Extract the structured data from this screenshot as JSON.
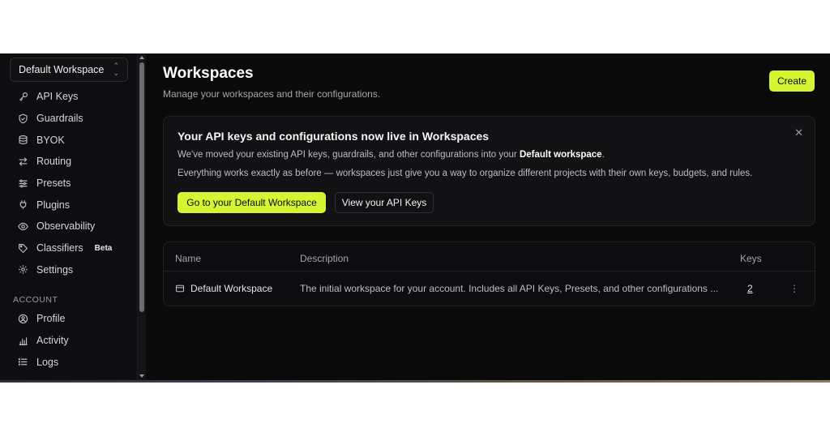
{
  "workspace_selector": {
    "label": "Default Workspace"
  },
  "sidebar": {
    "items": [
      {
        "label": "API Keys",
        "icon": "key-icon"
      },
      {
        "label": "Guardrails",
        "icon": "shield-icon"
      },
      {
        "label": "BYOK",
        "icon": "database-icon"
      },
      {
        "label": "Routing",
        "icon": "arrows-icon"
      },
      {
        "label": "Presets",
        "icon": "sliders-icon"
      },
      {
        "label": "Plugins",
        "icon": "plug-icon"
      },
      {
        "label": "Observability",
        "icon": "eye-icon"
      },
      {
        "label": "Classifiers",
        "icon": "tag-icon",
        "badge": "Beta"
      },
      {
        "label": "Settings",
        "icon": "gear-icon"
      }
    ],
    "section_label": "ACCOUNT",
    "account_items": [
      {
        "label": "Profile",
        "icon": "user-circle-icon"
      },
      {
        "label": "Activity",
        "icon": "bar-chart-icon"
      },
      {
        "label": "Logs",
        "icon": "list-icon"
      }
    ]
  },
  "header": {
    "title": "Workspaces",
    "subtitle": "Manage your workspaces and their configurations.",
    "create_label": "Create"
  },
  "banner": {
    "title": "Your API keys and configurations now live in Workspaces",
    "line1_prefix": "We've moved your existing API keys, guardrails, and other configurations into your ",
    "line1_bold": "Default workspace",
    "line1_suffix": ".",
    "line2": "Everything works exactly as before — workspaces just give you a way to organize different projects with their own keys, budgets, and rules.",
    "primary_label": "Go to your Default Workspace",
    "secondary_label": "View your API Keys",
    "close_glyph": "✕"
  },
  "table": {
    "headers": {
      "name": "Name",
      "description": "Description",
      "keys": "Keys"
    },
    "rows": [
      {
        "name": "Default Workspace",
        "description": "The initial workspace for your account. Includes all API Keys, Presets, and other configurations ...",
        "keys": "2",
        "more": "⋮"
      }
    ]
  },
  "colors": {
    "accent": "#d4f531",
    "background": "#0a0a0b"
  }
}
